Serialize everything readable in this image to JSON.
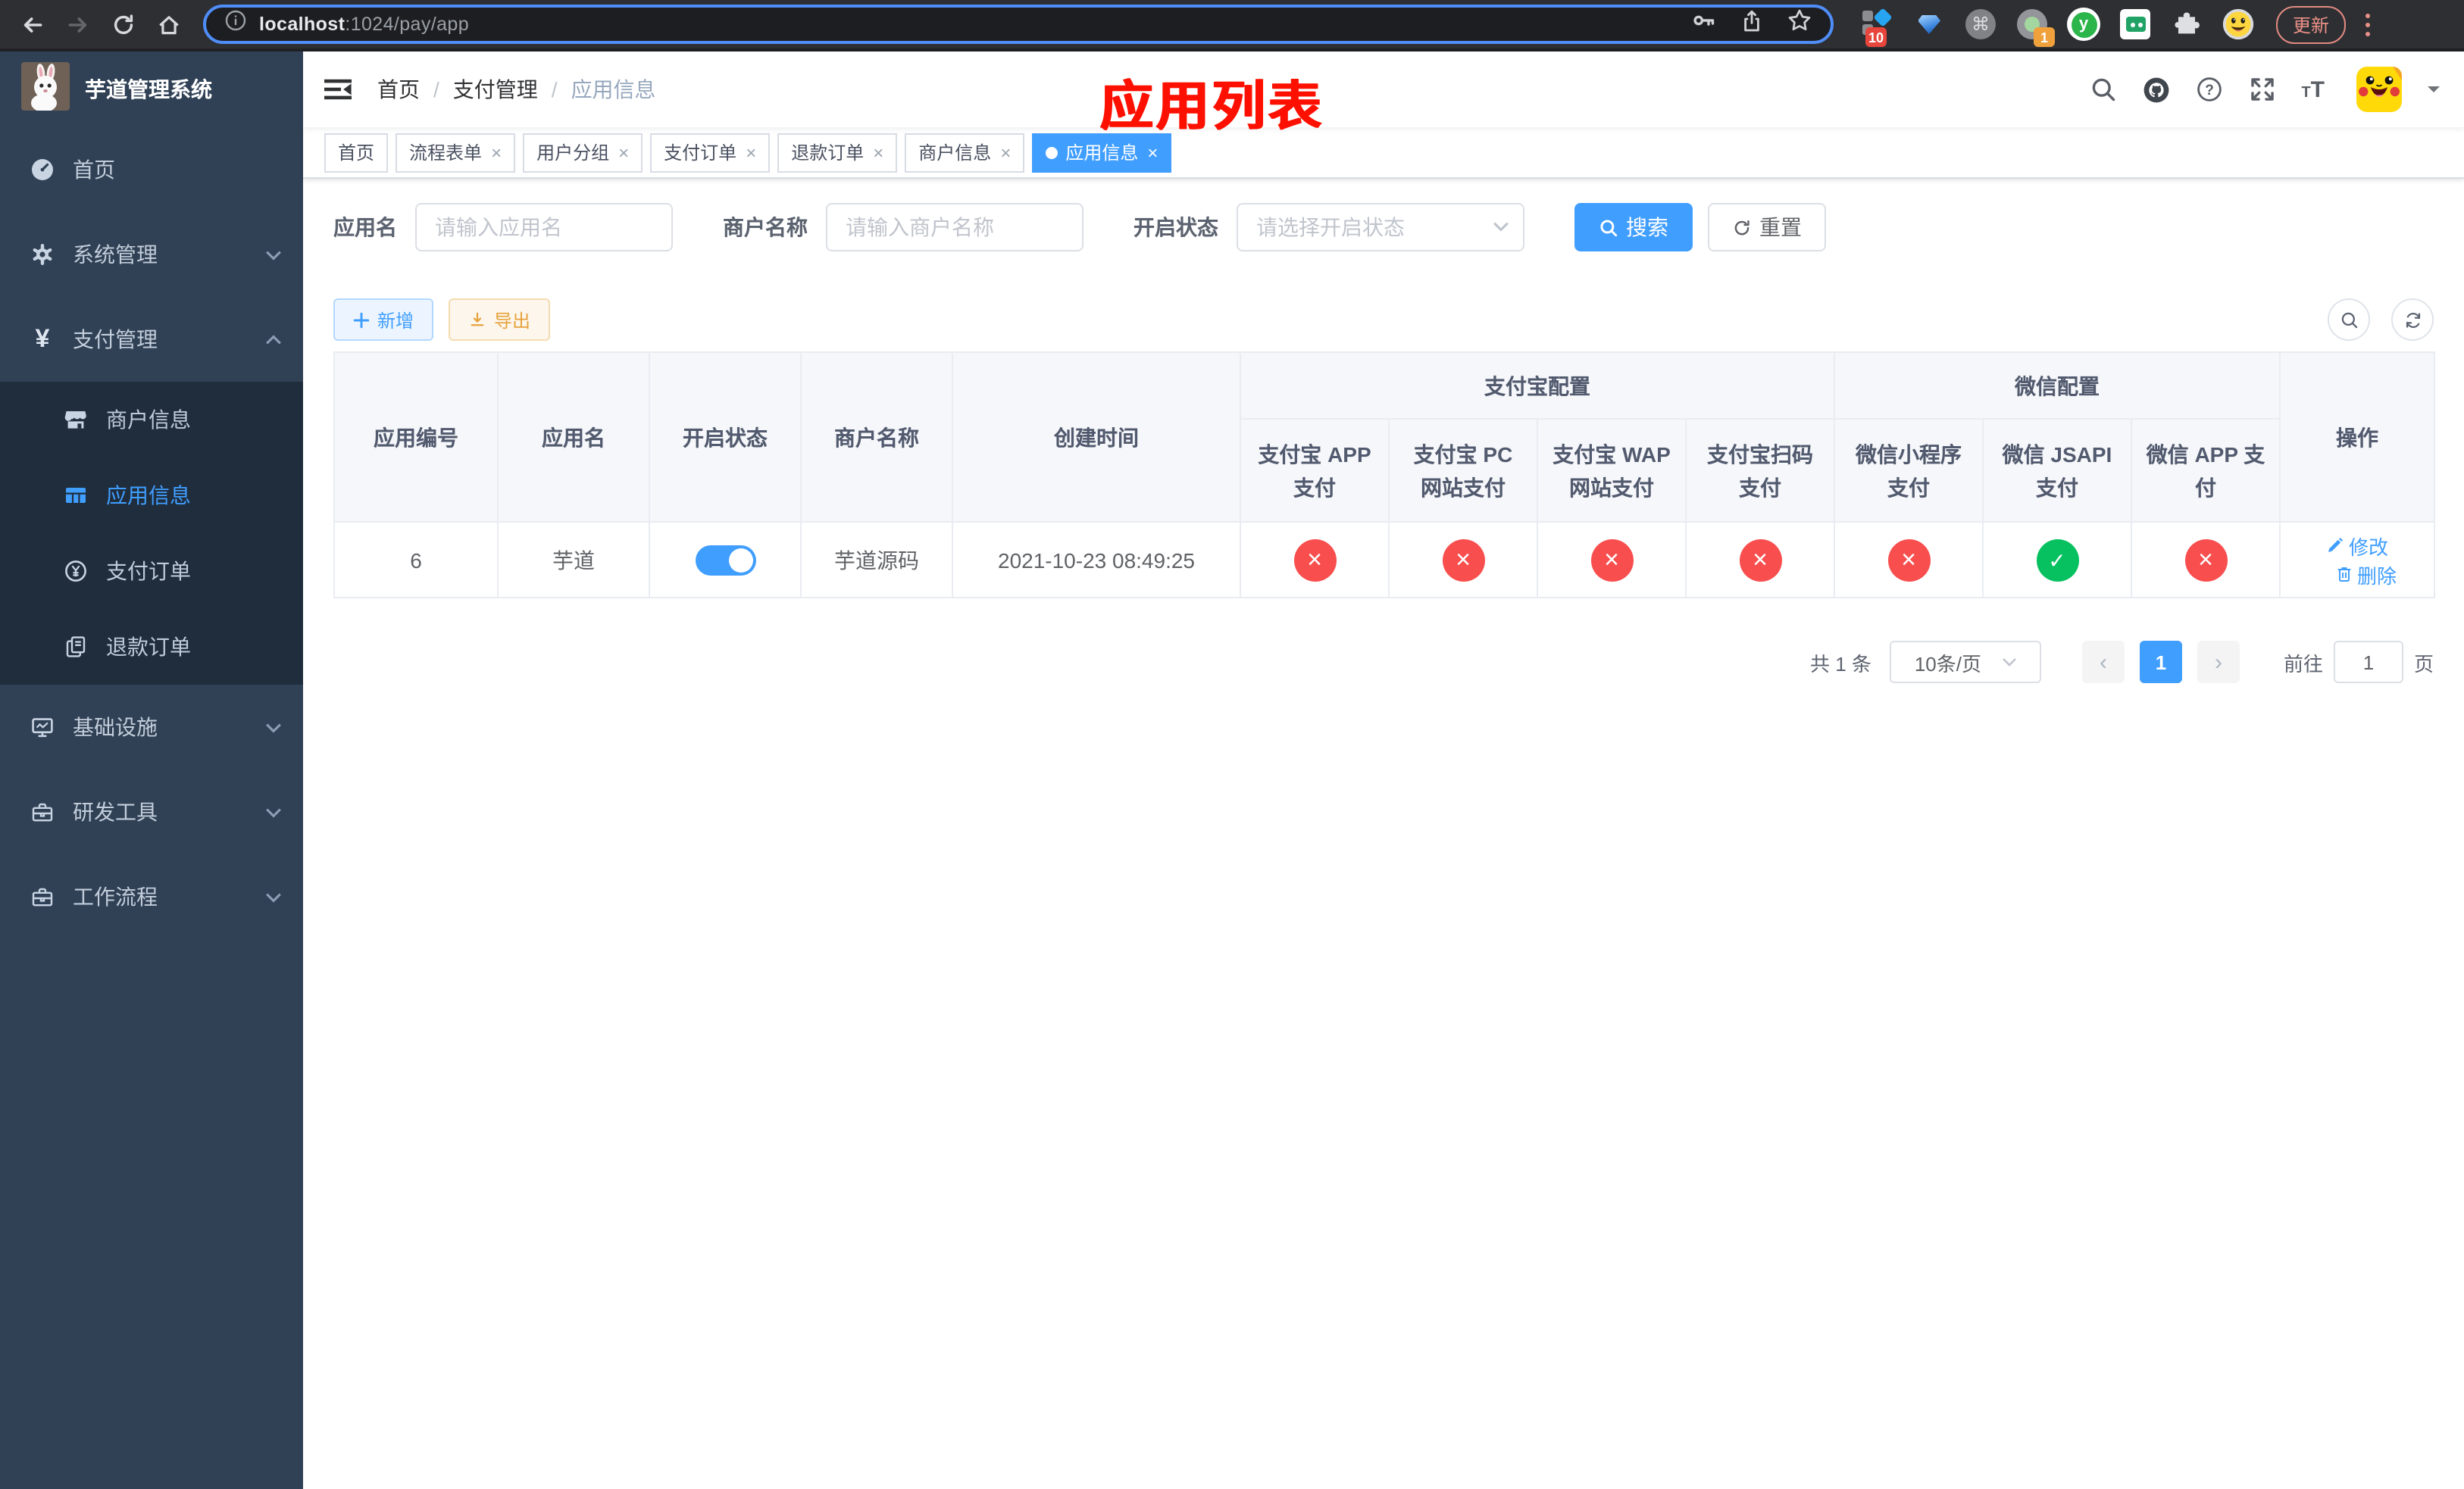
{
  "colors": {
    "accent": "#409eff",
    "success": "#07c160",
    "danger": "#f84e4e",
    "sidebar_bg": "#304156",
    "submenu_bg": "#1f2d3d",
    "annotation_red": "#fe1000"
  },
  "browser": {
    "url_host": "localhost",
    "url_path": ":1024/pay/app",
    "update_label": "更新",
    "extensions": {
      "badge_grid": "10",
      "badge_recorder": "1",
      "y_letter": "y",
      "cmd_symbol": "⌘"
    }
  },
  "annotation": {
    "text": "应用列表"
  },
  "sidebar": {
    "title": "芋道管理系统",
    "menu": [
      {
        "label": "首页",
        "icon": "dashboard-icon"
      },
      {
        "label": "系统管理",
        "icon": "gear-icon"
      },
      {
        "label": "支付管理",
        "icon": "yen-icon"
      },
      {
        "label": "商户信息",
        "icon": "shop-icon"
      },
      {
        "label": "应用信息",
        "icon": "grid-icon"
      },
      {
        "label": "支付订单",
        "icon": "yen-circle-icon"
      },
      {
        "label": "退款订单",
        "icon": "document-icon"
      },
      {
        "label": "基础设施",
        "icon": "monitor-icon"
      },
      {
        "label": "研发工具",
        "icon": "toolbox-icon"
      },
      {
        "label": "工作流程",
        "icon": "briefcase-icon"
      }
    ]
  },
  "breadcrumb": {
    "items": [
      "首页",
      "支付管理",
      "应用信息"
    ],
    "separator": "/"
  },
  "tabs": [
    {
      "label": "首页"
    },
    {
      "label": "流程表单"
    },
    {
      "label": "用户分组"
    },
    {
      "label": "支付订单"
    },
    {
      "label": "退款订单"
    },
    {
      "label": "商户信息"
    },
    {
      "label": "应用信息"
    }
  ],
  "filters": {
    "app_name_label": "应用名",
    "app_name_placeholder": "请输入应用名",
    "merchant_label": "商户名称",
    "merchant_placeholder": "请输入商户名称",
    "status_label": "开启状态",
    "status_placeholder": "请选择开启状态",
    "search_label": "搜索",
    "reset_label": "重置"
  },
  "toolbar": {
    "add_label": "新增",
    "export_label": "导出"
  },
  "table": {
    "columns": {
      "app_id": "应用编号",
      "app_name": "应用名",
      "status": "开启状态",
      "merchant": "商户名称",
      "create_time": "创建时间",
      "group_alipay": "支付宝配置",
      "group_wechat": "微信配置",
      "alipay_app": "支付宝 APP 支付",
      "alipay_pc": "支付宝 PC 网站支付",
      "alipay_wap": "支付宝 WAP 网站支付",
      "alipay_qr": "支付宝扫码支付",
      "wechat_mini": "微信小程序支付",
      "wechat_jsapi": "微信 JSAPI 支付",
      "wechat_app": "微信 APP 支付",
      "actions": "操作"
    },
    "row": {
      "app_id": "6",
      "app_name": "芋道",
      "merchant": "芋道源码",
      "create_time": "2021-10-23 08:49:25",
      "pay_status": [
        "fail",
        "fail",
        "fail",
        "fail",
        "fail",
        "ok",
        "fail"
      ],
      "edit_label": "修改",
      "delete_label": "删除"
    }
  },
  "pagination": {
    "total_label": "共 1 条",
    "page_size_label": "10条/页",
    "prev_glyph": "‹",
    "current_page": "1",
    "next_glyph": "›",
    "goto_label": "前往",
    "goto_value": "1",
    "page_suffix": "页"
  },
  "icons": {
    "close_glyph": "×",
    "question_glyph": "?"
  }
}
